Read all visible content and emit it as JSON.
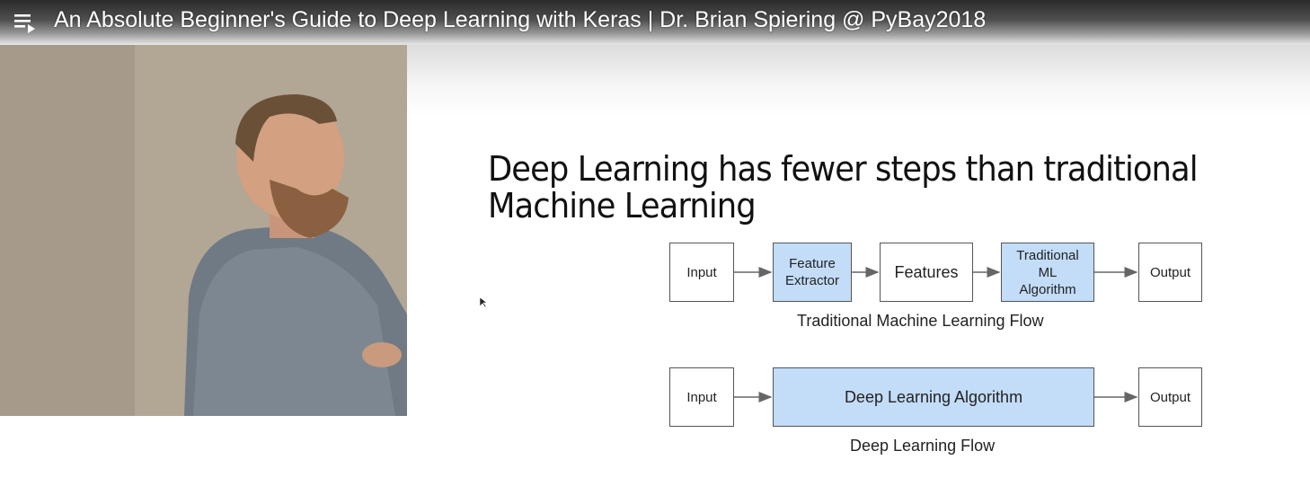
{
  "player": {
    "title": "An Absolute Beginner's Guide to Deep Learning with Keras | Dr. Brian Spiering @ PyBay2018",
    "playlist_icon": "playlist-icon"
  },
  "slide": {
    "heading": "Deep Learning has fewer steps than traditional Machine Learning",
    "traditional_flow": {
      "steps": [
        "Input",
        "Feature Extractor",
        "Features",
        "Traditional ML Algorithm",
        "Output"
      ],
      "label": "Traditional Machine Learning Flow"
    },
    "deep_flow": {
      "steps": [
        "Input",
        "Deep Learning Algorithm",
        "Output"
      ],
      "label": "Deep Learning Flow"
    },
    "highlight_color": "#c3dcf8"
  }
}
